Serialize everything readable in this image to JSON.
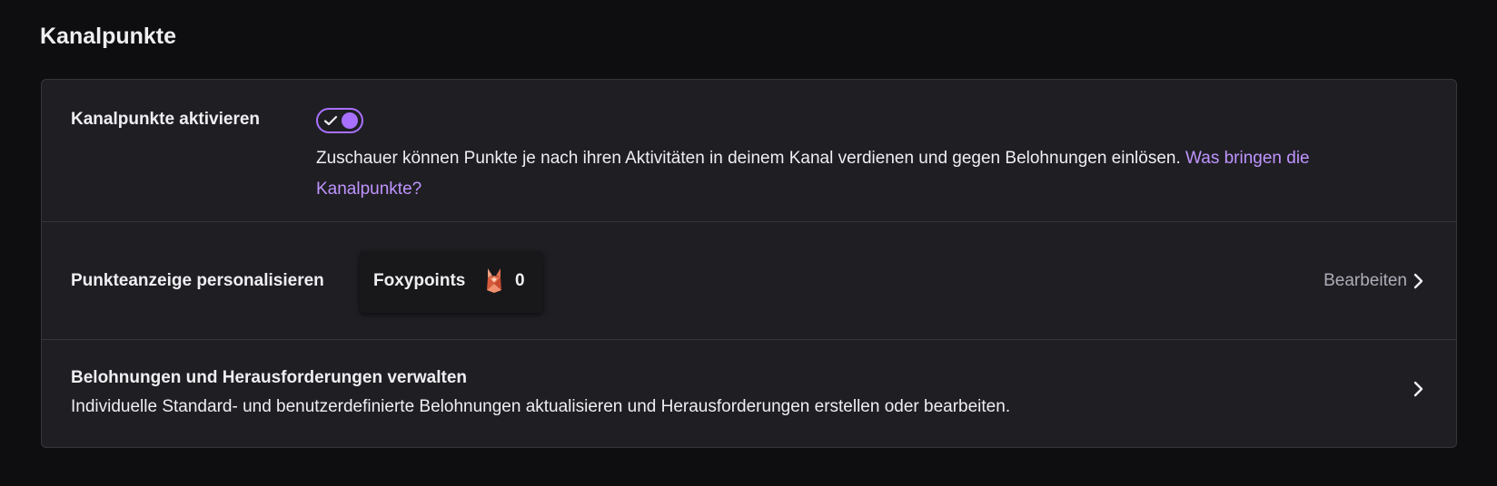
{
  "section": {
    "title": "Kanalpunkte"
  },
  "enable_row": {
    "label": "Kanalpunkte aktivieren",
    "toggle_on": true,
    "description": "Zuschauer können Punkte je nach ihren Aktivitäten in deinem Kanal verdienen und gegen Belohnungen einlösen.",
    "link_text": "Was bringen die Kanalpunkte?"
  },
  "display_row": {
    "label": "Punkteanzeige personalisieren",
    "points_name": "Foxypoints",
    "points_icon": "fox-icon",
    "points_value": "0",
    "edit_label": "Bearbeiten"
  },
  "rewards_row": {
    "label": "Belohnungen und Herausforderungen verwalten",
    "description": "Individuelle Standard- und benutzerdefinierte Belohnungen aktualisieren und Herausforderungen erstellen oder bearbeiten."
  },
  "colors": {
    "background": "#0e0e10",
    "panel": "#1f1f23",
    "accent": "#a970ff",
    "link": "#bf94ff",
    "muted_text": "#adadb8"
  }
}
